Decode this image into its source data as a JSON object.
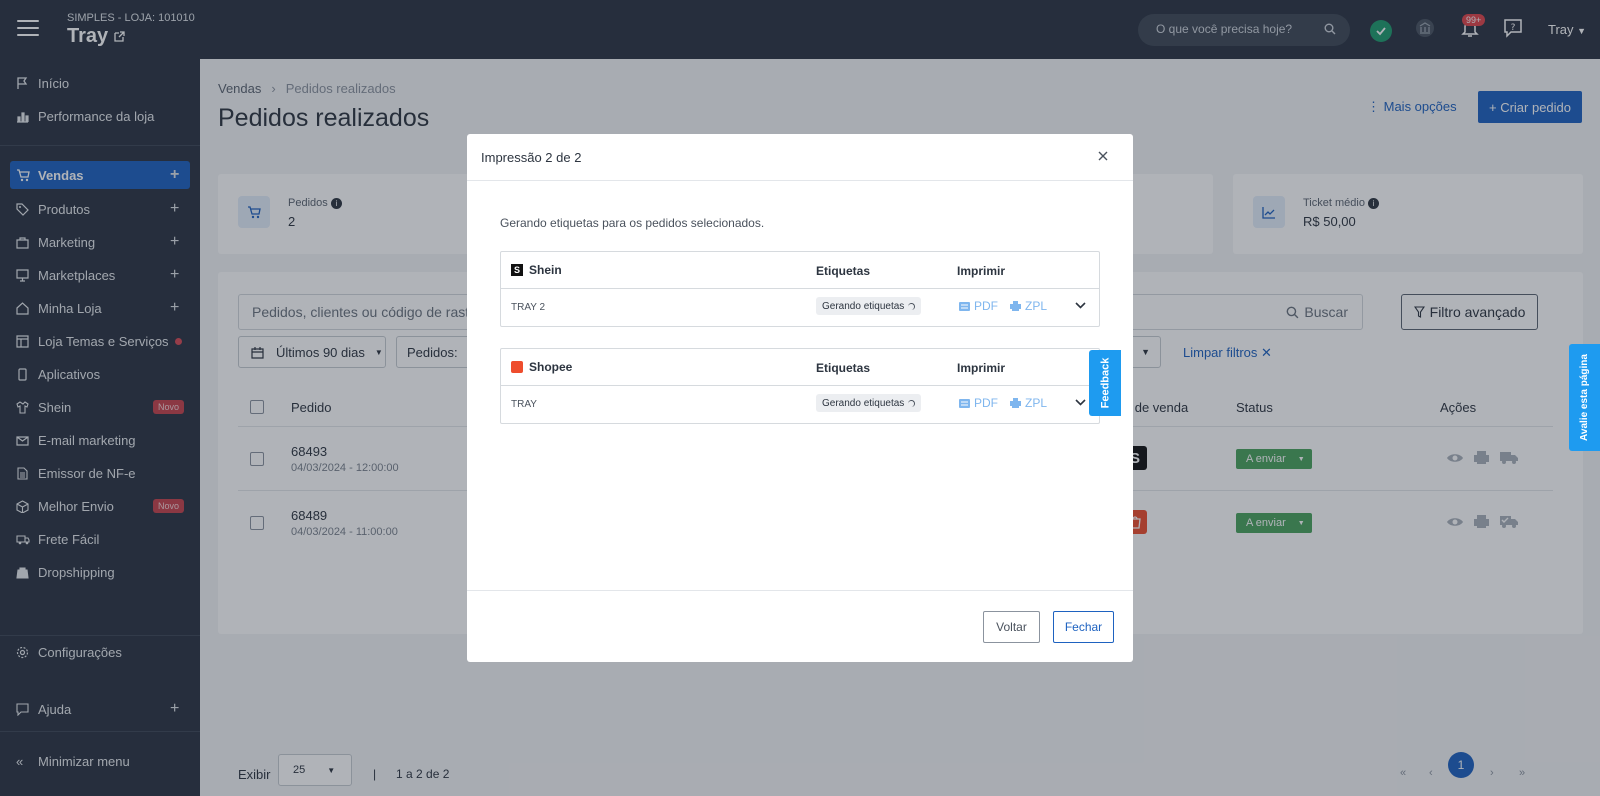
{
  "topbar": {
    "store_sub": "SIMPLES - LOJA: 101010",
    "store_name": "Tray",
    "search_placeholder": "O que você precisa hoje?",
    "notif_count": "99+",
    "user_label": "Tray"
  },
  "sidebar": {
    "items": [
      {
        "label": "Início",
        "icon": "flag-icon"
      },
      {
        "label": "Performance da loja",
        "icon": "bar-chart-icon"
      },
      {
        "label": "Vendas",
        "icon": "cart-icon",
        "plus": "+"
      },
      {
        "label": "Produtos",
        "icon": "tag-icon",
        "plus": "+"
      },
      {
        "label": "Marketing",
        "icon": "basket-icon",
        "plus": "+"
      },
      {
        "label": "Marketplaces",
        "icon": "monitor-icon",
        "plus": "+"
      },
      {
        "label": "Minha Loja",
        "icon": "home-icon",
        "plus": "+"
      },
      {
        "label": "Loja Temas e Serviços",
        "icon": "layout-icon"
      },
      {
        "label": "Aplicativos",
        "icon": "phone-icon"
      },
      {
        "label": "Shein",
        "icon": "shirt-icon",
        "badge": "Novo"
      },
      {
        "label": "E-mail marketing",
        "icon": "mail-icon"
      },
      {
        "label": "Emissor de NF-e",
        "icon": "document-icon"
      },
      {
        "label": "Melhor Envio",
        "icon": "box-icon",
        "badge": "Novo"
      },
      {
        "label": "Frete Fácil",
        "icon": "truck-icon"
      },
      {
        "label": "Dropshipping",
        "icon": "bag-icon"
      },
      {
        "label": "Configurações",
        "icon": "gear-icon"
      },
      {
        "label": "Ajuda",
        "icon": "help-icon",
        "plus": "+"
      },
      {
        "label": "Minimizar menu",
        "icon": "double-chevron-left-icon"
      }
    ]
  },
  "main": {
    "breadcrumb": {
      "root": "Vendas",
      "current": "Pedidos realizados"
    },
    "title": "Pedidos realizados",
    "more_options": "Mais opções",
    "create_order": "+ Criar pedido",
    "cards": [
      {
        "label": "Pedidos",
        "value": "2"
      },
      {
        "label": "Ticket médio",
        "value": "R$ 50,00"
      }
    ],
    "search_placeholder": "Pedidos, clientes ou código de rastreio",
    "search_button": "Buscar",
    "advanced_filter": "Filtro avançado",
    "date_filter": "Últimos 90 dias",
    "orders_filter": "Pedidos:",
    "clear_filters": "Limpar filtros",
    "columns": {
      "order": "Pedido",
      "channel": "al de venda",
      "status": "Status",
      "actions": "Ações"
    },
    "rows": [
      {
        "number": "68493",
        "date": "04/03/2024 - 12:00:00",
        "status": "A enviar",
        "channel": "Shein"
      },
      {
        "number": "68489",
        "date": "04/03/2024 - 11:00:00",
        "status": "A enviar",
        "channel": "Shopee"
      }
    ],
    "pagination": {
      "show_label": "Exibir",
      "page_size": "25",
      "separator": "|",
      "range": "1 a 2 de 2",
      "current_page": "1",
      "first": "«",
      "prev": "‹",
      "next": "›",
      "last": "»"
    }
  },
  "modal": {
    "title": "Impressão 2 de 2",
    "description": "Gerando etiquetas para os pedidos selecionados.",
    "col_labels": "Etiquetas",
    "col_print": "Imprimir",
    "marketplaces": [
      {
        "name": "Shein",
        "order": "TRAY 2",
        "label_status": "Gerando etiquetas",
        "pdf": "PDF",
        "zpl": "ZPL",
        "logo_color": "#111111"
      },
      {
        "name": "Shopee",
        "order": "TRAY",
        "label_status": "Gerando etiquetas",
        "pdf": "PDF",
        "zpl": "ZPL",
        "logo_color": "#ee4d2d"
      }
    ],
    "back_button": "Voltar",
    "close_button": "Fechar"
  },
  "feedback_tab": "Feedback",
  "rate_tab": "Avalie esta página",
  "colors": {
    "primary": "#1e62c0",
    "sidebar": "#2b3442",
    "success": "#4aa35d",
    "feedback": "#1e9bf0"
  }
}
